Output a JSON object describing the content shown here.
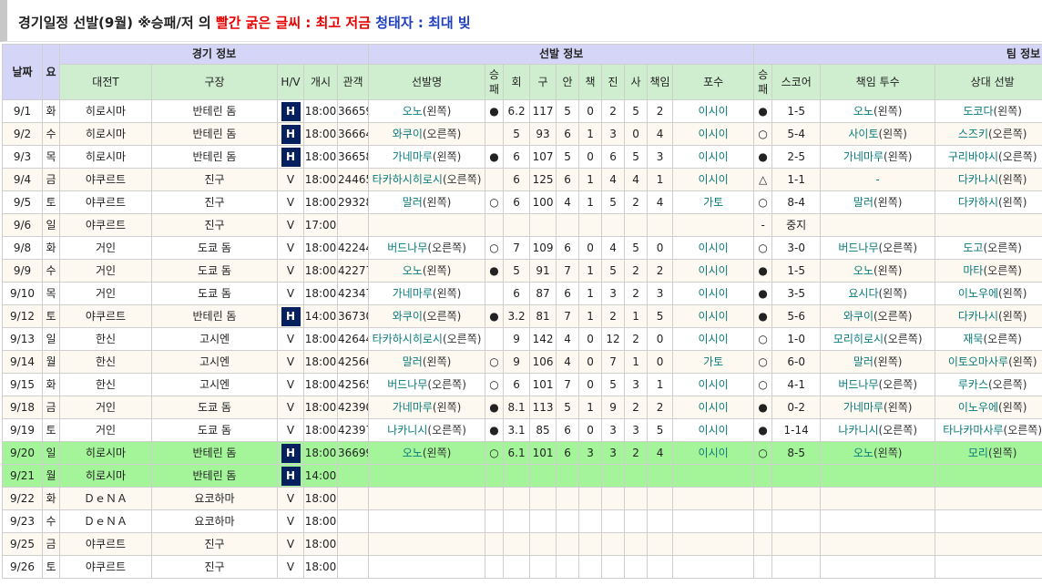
{
  "title": {
    "part1": "경기일정 선발(9월) ※승패/저 의 ",
    "part2": "빨간 굵은 글씨 : 최고 저금",
    "part3": " 청태자 : 최대 빚"
  },
  "groups": {
    "game": "경기 정보",
    "starter": "선발 정보",
    "team": "팀 정보"
  },
  "headers": {
    "date": "날짜",
    "day": "요",
    "opponent": "대전T",
    "venue": "구장",
    "hv": "H/V",
    "start": "개시",
    "attendance": "관객",
    "starter_name": "선발명",
    "wl": "승\n패",
    "inn": "회",
    "pitches": "구",
    "hits": "안",
    "runs": "책",
    "bb": "진",
    "so": "사",
    "er": "책임",
    "catcher": "포수",
    "team_wl": "승\n패",
    "score": "스코어",
    "rp": "책임 투수",
    "opp_starter": "상대 선발"
  },
  "rows": [
    {
      "date": "9/1",
      "day": "화",
      "opp": "히로시마",
      "venue": "반테린 돔",
      "hv": "H",
      "start": "18:00",
      "att": "36659",
      "sp": "오노",
      "hand": "(왼쪽)",
      "wl": "●",
      "inn": "6.2",
      "pc": "117",
      "h": "5",
      "r": "0",
      "bb": "2",
      "so": "5",
      "er": "2",
      "c": "이시이",
      "twl": "●",
      "score": "1-5",
      "rp": "오노",
      "rph": "(왼쪽)",
      "os": "도코다",
      "osh": "(왼쪽)"
    },
    {
      "date": "9/2",
      "day": "수",
      "opp": "히로시마",
      "venue": "반테린 돔",
      "hv": "H",
      "start": "18:00",
      "att": "36664",
      "sp": "와쿠이",
      "hand": "(오른쪽)",
      "wl": "",
      "inn": "5",
      "pc": "93",
      "h": "6",
      "r": "1",
      "bb": "3",
      "so": "0",
      "er": "4",
      "c": "이시이",
      "twl": "○",
      "score": "5-4",
      "rp": "사이토",
      "rph": "(왼쪽)",
      "os": "스즈키",
      "osh": "(오른쪽)"
    },
    {
      "date": "9/3",
      "day": "목",
      "opp": "히로시마",
      "venue": "반테린 돔",
      "hv": "H",
      "start": "18:00",
      "att": "36658",
      "sp": "가네마루",
      "hand": "(왼쪽)",
      "wl": "●",
      "inn": "6",
      "pc": "107",
      "h": "5",
      "r": "0",
      "bb": "6",
      "so": "5",
      "er": "3",
      "c": "이시이",
      "twl": "●",
      "score": "2-5",
      "rp": "가네마루",
      "rph": "(왼쪽)",
      "os": "구리바야시",
      "osh": "(오른쪽)"
    },
    {
      "date": "9/4",
      "day": "금",
      "opp": "야쿠르트",
      "venue": "진구",
      "hv": "V",
      "start": "18:00",
      "att": "24465",
      "sp": "타카하시히로시",
      "hand": "(오른쪽)",
      "wl": "",
      "inn": "6",
      "pc": "125",
      "h": "6",
      "r": "1",
      "bb": "4",
      "so": "4",
      "er": "1",
      "c": "이시이",
      "twl": "△",
      "score": "1-1",
      "rp": "-",
      "rph": "",
      "os": "다카나시",
      "osh": "(왼쪽)"
    },
    {
      "date": "9/5",
      "day": "토",
      "opp": "야쿠르트",
      "venue": "진구",
      "hv": "V",
      "start": "18:00",
      "att": "29328",
      "sp": "말러",
      "hand": "(왼쪽)",
      "wl": "○",
      "inn": "6",
      "pc": "100",
      "h": "4",
      "r": "1",
      "bb": "5",
      "so": "2",
      "er": "4",
      "c": "가토",
      "twl": "○",
      "score": "8-4",
      "rp": "말러",
      "rph": "(왼쪽)",
      "os": "다카하시",
      "osh": "(왼쪽)"
    },
    {
      "date": "9/6",
      "day": "일",
      "opp": "야쿠르트",
      "venue": "진구",
      "hv": "V",
      "start": "17:00",
      "att": "",
      "sp": "",
      "hand": "",
      "wl": "",
      "inn": "",
      "pc": "",
      "h": "",
      "r": "",
      "bb": "",
      "so": "",
      "er": "",
      "c": "",
      "twl": "-",
      "score": "중지",
      "rp": "",
      "rph": "",
      "os": "",
      "osh": ""
    },
    {
      "date": "9/8",
      "day": "화",
      "opp": "거인",
      "venue": "도쿄 돔",
      "hv": "V",
      "start": "18:00",
      "att": "42244",
      "sp": "버드나무",
      "hand": "(오른쪽)",
      "wl": "○",
      "inn": "7",
      "pc": "109",
      "h": "6",
      "r": "0",
      "bb": "4",
      "so": "5",
      "er": "0",
      "c": "이시이",
      "twl": "○",
      "score": "3-0",
      "rp": "버드나무",
      "rph": "(오른쪽)",
      "os": "도고",
      "osh": "(오른쪽)"
    },
    {
      "date": "9/9",
      "day": "수",
      "opp": "거인",
      "venue": "도쿄 돔",
      "hv": "V",
      "start": "18:00",
      "att": "42277",
      "sp": "오노",
      "hand": "(왼쪽)",
      "wl": "●",
      "inn": "5",
      "pc": "91",
      "h": "7",
      "r": "1",
      "bb": "5",
      "so": "2",
      "er": "2",
      "c": "이시이",
      "twl": "●",
      "score": "1-5",
      "rp": "오노",
      "rph": "(왼쪽)",
      "os": "마타",
      "osh": "(오른쪽)"
    },
    {
      "date": "9/10",
      "day": "목",
      "opp": "거인",
      "venue": "도쿄 돔",
      "hv": "V",
      "start": "18:00",
      "att": "42347",
      "sp": "가네마루",
      "hand": "(왼쪽)",
      "wl": "",
      "inn": "6",
      "pc": "87",
      "h": "6",
      "r": "1",
      "bb": "3",
      "so": "2",
      "er": "3",
      "c": "이시이",
      "twl": "●",
      "score": "3-5",
      "rp": "요시다",
      "rph": "(왼쪽)",
      "os": "이노우에",
      "osh": "(왼쪽)"
    },
    {
      "date": "9/12",
      "day": "토",
      "opp": "야쿠르트",
      "venue": "반테린 돔",
      "hv": "H",
      "start": "14:00",
      "att": "36730",
      "sp": "와쿠이",
      "hand": "(오른쪽)",
      "wl": "●",
      "inn": "3.2",
      "pc": "81",
      "h": "7",
      "r": "1",
      "bb": "2",
      "so": "1",
      "er": "5",
      "c": "이시이",
      "twl": "●",
      "score": "5-6",
      "rp": "와쿠이",
      "rph": "(오른쪽)",
      "os": "다카나시",
      "osh": "(왼쪽)"
    },
    {
      "date": "9/13",
      "day": "일",
      "opp": "한신",
      "venue": "고시엔",
      "hv": "V",
      "start": "18:00",
      "att": "42644",
      "sp": "타카하시히로시",
      "hand": "(오른쪽)",
      "wl": "",
      "inn": "9",
      "pc": "142",
      "h": "4",
      "r": "0",
      "bb": "12",
      "so": "2",
      "er": "0",
      "c": "이시이",
      "twl": "○",
      "score": "1-0",
      "rp": "모리히로시",
      "rph": "(오른쪽)",
      "os": "재묵",
      "osh": "(오른쪽)"
    },
    {
      "date": "9/14",
      "day": "월",
      "opp": "한신",
      "venue": "고시엔",
      "hv": "V",
      "start": "18:00",
      "att": "42566",
      "sp": "말러",
      "hand": "(왼쪽)",
      "wl": "○",
      "inn": "9",
      "pc": "106",
      "h": "4",
      "r": "0",
      "bb": "7",
      "so": "1",
      "er": "0",
      "c": "가토",
      "twl": "○",
      "score": "6-0",
      "rp": "말러",
      "rph": "(왼쪽)",
      "os": "이토오마사루",
      "osh": "(왼쪽)"
    },
    {
      "date": "9/15",
      "day": "화",
      "opp": "한신",
      "venue": "고시엔",
      "hv": "V",
      "start": "18:00",
      "att": "42565",
      "sp": "버드나무",
      "hand": "(오른쪽)",
      "wl": "○",
      "inn": "6",
      "pc": "101",
      "h": "7",
      "r": "0",
      "bb": "5",
      "so": "3",
      "er": "1",
      "c": "이시이",
      "twl": "○",
      "score": "4-1",
      "rp": "버드나무",
      "rph": "(오른쪽)",
      "os": "루카스",
      "osh": "(오른쪽)"
    },
    {
      "date": "9/18",
      "day": "금",
      "opp": "거인",
      "venue": "도쿄 돔",
      "hv": "V",
      "start": "18:00",
      "att": "42390",
      "sp": "가네마루",
      "hand": "(왼쪽)",
      "wl": "●",
      "inn": "8.1",
      "pc": "113",
      "h": "5",
      "r": "1",
      "bb": "9",
      "so": "2",
      "er": "2",
      "c": "이시이",
      "twl": "●",
      "score": "0-2",
      "rp": "가네마루",
      "rph": "(왼쪽)",
      "os": "이노우에",
      "osh": "(왼쪽)"
    },
    {
      "date": "9/19",
      "day": "토",
      "opp": "거인",
      "venue": "도쿄 돔",
      "hv": "V",
      "start": "18:00",
      "att": "42397",
      "sp": "나카니시",
      "hand": "(오른쪽)",
      "wl": "●",
      "inn": "3.1",
      "pc": "85",
      "h": "6",
      "r": "0",
      "bb": "3",
      "so": "3",
      "er": "5",
      "c": "이시이",
      "twl": "●",
      "score": "1-14",
      "rp": "나카니시",
      "rph": "(오른쪽)",
      "os": "타나카마사루",
      "osh": "(오른쪽)"
    },
    {
      "date": "9/20",
      "day": "일",
      "opp": "히로시마",
      "venue": "반테린 돔",
      "hv": "H",
      "start": "18:00",
      "att": "36699",
      "sp": "오노",
      "hand": "(왼쪽)",
      "wl": "○",
      "inn": "6.1",
      "pc": "101",
      "h": "6",
      "r": "3",
      "bb": "3",
      "so": "2",
      "er": "4",
      "c": "이시이",
      "twl": "○",
      "score": "8-5",
      "rp": "오노",
      "rph": "(왼쪽)",
      "os": "모리",
      "osh": "(왼쪽)",
      "hl": true
    },
    {
      "date": "9/21",
      "day": "월",
      "opp": "히로시마",
      "venue": "반테린 돔",
      "hv": "H",
      "start": "14:00",
      "att": "",
      "sp": "",
      "hand": "",
      "wl": "",
      "inn": "",
      "pc": "",
      "h": "",
      "r": "",
      "bb": "",
      "so": "",
      "er": "",
      "c": "",
      "twl": "",
      "score": "",
      "rp": "",
      "rph": "",
      "os": "",
      "osh": "",
      "hl": true
    },
    {
      "date": "9/22",
      "day": "화",
      "opp": "ＤｅＮＡ",
      "venue": "요코하마",
      "hv": "V",
      "start": "18:00",
      "att": "",
      "sp": "",
      "hand": "",
      "wl": "",
      "inn": "",
      "pc": "",
      "h": "",
      "r": "",
      "bb": "",
      "so": "",
      "er": "",
      "c": "",
      "twl": "",
      "score": "",
      "rp": "",
      "rph": "",
      "os": "",
      "osh": ""
    },
    {
      "date": "9/23",
      "day": "수",
      "opp": "ＤｅＮＡ",
      "venue": "요코하마",
      "hv": "V",
      "start": "18:00",
      "att": "",
      "sp": "",
      "hand": "",
      "wl": "",
      "inn": "",
      "pc": "",
      "h": "",
      "r": "",
      "bb": "",
      "so": "",
      "er": "",
      "c": "",
      "twl": "",
      "score": "",
      "rp": "",
      "rph": "",
      "os": "",
      "osh": ""
    },
    {
      "date": "9/25",
      "day": "금",
      "opp": "야쿠르트",
      "venue": "진구",
      "hv": "V",
      "start": "18:00",
      "att": "",
      "sp": "",
      "hand": "",
      "wl": "",
      "inn": "",
      "pc": "",
      "h": "",
      "r": "",
      "bb": "",
      "so": "",
      "er": "",
      "c": "",
      "twl": "",
      "score": "",
      "rp": "",
      "rph": "",
      "os": "",
      "osh": ""
    },
    {
      "date": "9/26",
      "day": "토",
      "opp": "야쿠르트",
      "venue": "진구",
      "hv": "V",
      "start": "18:00",
      "att": "",
      "sp": "",
      "hand": "",
      "wl": "",
      "inn": "",
      "pc": "",
      "h": "",
      "r": "",
      "bb": "",
      "so": "",
      "er": "",
      "c": "",
      "twl": "",
      "score": "",
      "rp": "",
      "rph": "",
      "os": "",
      "osh": ""
    }
  ]
}
